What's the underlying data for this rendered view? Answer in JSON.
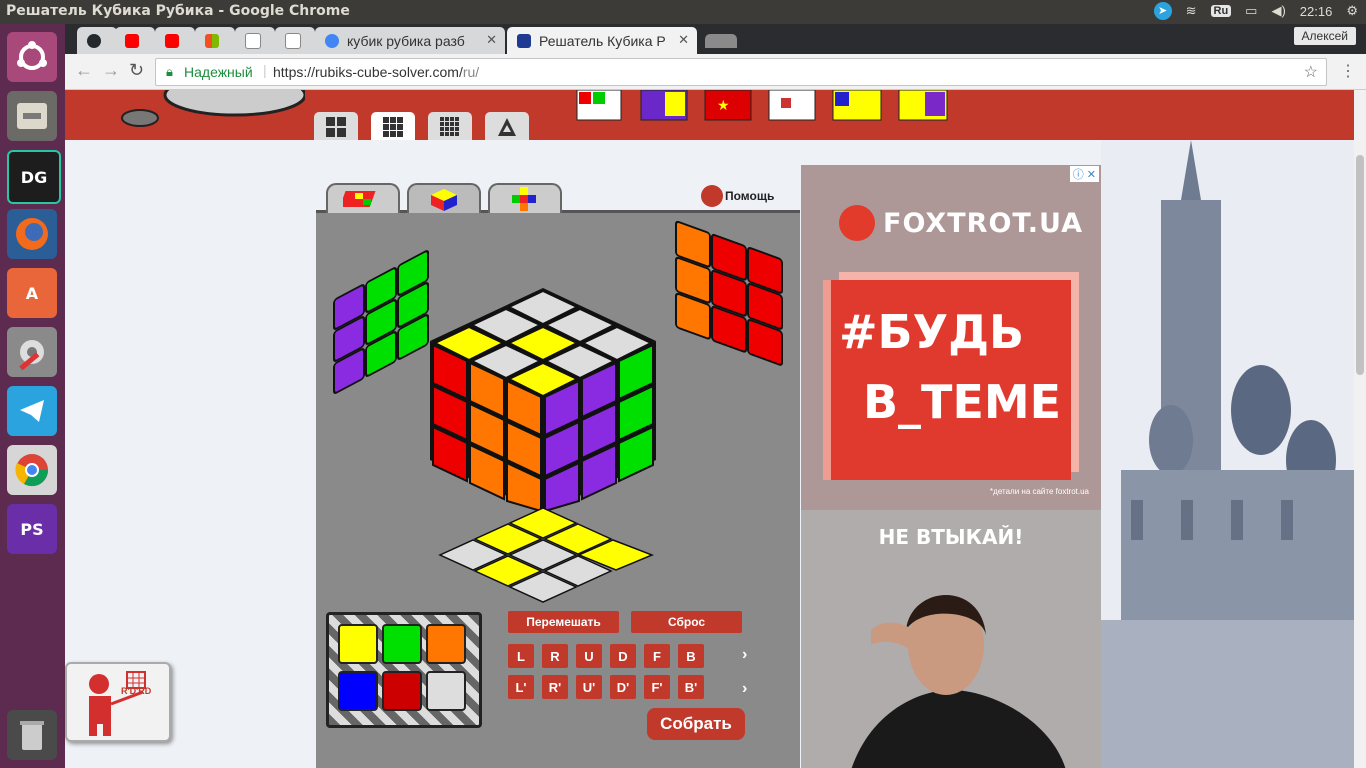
{
  "window": {
    "title": "Решатель Кубика Рубика - Google Chrome"
  },
  "tray": {
    "keyboard_layout": "Ru",
    "clock": "22:16"
  },
  "launcher": {
    "items": [
      {
        "name": "ubuntu-icon",
        "label": ""
      },
      {
        "name": "files-icon",
        "label": ""
      },
      {
        "name": "datagrip-icon",
        "label": "DG"
      },
      {
        "name": "firefox-icon",
        "label": ""
      },
      {
        "name": "software-center-icon",
        "label": "A"
      },
      {
        "name": "settings-icon",
        "label": ""
      },
      {
        "name": "telegram-icon",
        "label": ""
      },
      {
        "name": "chrome-icon",
        "label": ""
      },
      {
        "name": "phpstorm-icon",
        "label": "PS"
      },
      {
        "name": "trash-icon",
        "label": ""
      }
    ]
  },
  "tabs": [
    {
      "label": "",
      "icon": "github-icon",
      "color": "#24292e"
    },
    {
      "label": "",
      "icon": "youtube-icon",
      "color": "#ff0000"
    },
    {
      "label": "",
      "icon": "youtube-icon",
      "color": "#ff0000"
    },
    {
      "label": "",
      "icon": "microsoft-icon",
      "color": "#f25022"
    },
    {
      "label": "",
      "icon": "page-icon",
      "color": "#9e9e9e"
    },
    {
      "label": "",
      "icon": "page-icon",
      "color": "#9e9e9e"
    },
    {
      "label": "кубик рубика разб",
      "icon": "google-icon",
      "color": "#4285f4"
    },
    {
      "label": "Решатель Кубика Р",
      "icon": "cube-icon",
      "color": "#1f3a93",
      "active": true
    }
  ],
  "profile": {
    "name": "Алексей"
  },
  "address": {
    "secure_label": "Надежный",
    "url_main": "https://rubiks-cube-solver.com/",
    "url_path": "ru/"
  },
  "solver": {
    "help_label": "Помощь",
    "scramble_label": "Перемешать",
    "reset_label": "Сброс",
    "moves_row1": [
      "L",
      "R",
      "U",
      "D",
      "F",
      "B"
    ],
    "moves_row2": [
      "L'",
      "R'",
      "U'",
      "D'",
      "F'",
      "B'"
    ],
    "solve_label": "Собрать",
    "palette": [
      "#ffff00",
      "#00e000",
      "#ff7700",
      "#0000ff",
      "#cc0000",
      "#dddddd"
    ]
  },
  "ad": {
    "brand": "FOXTROT.UA",
    "headline_line1": "#БУДЬ",
    "headline_line2": "В_ТЕМЕ",
    "fineprint": "*детали на сайте foxtrot.ua",
    "subline": "НЕ ВТЫКАЙ!"
  },
  "badge": {
    "label": "R'D'RD"
  },
  "colors": {
    "accent": "#c0392b"
  }
}
